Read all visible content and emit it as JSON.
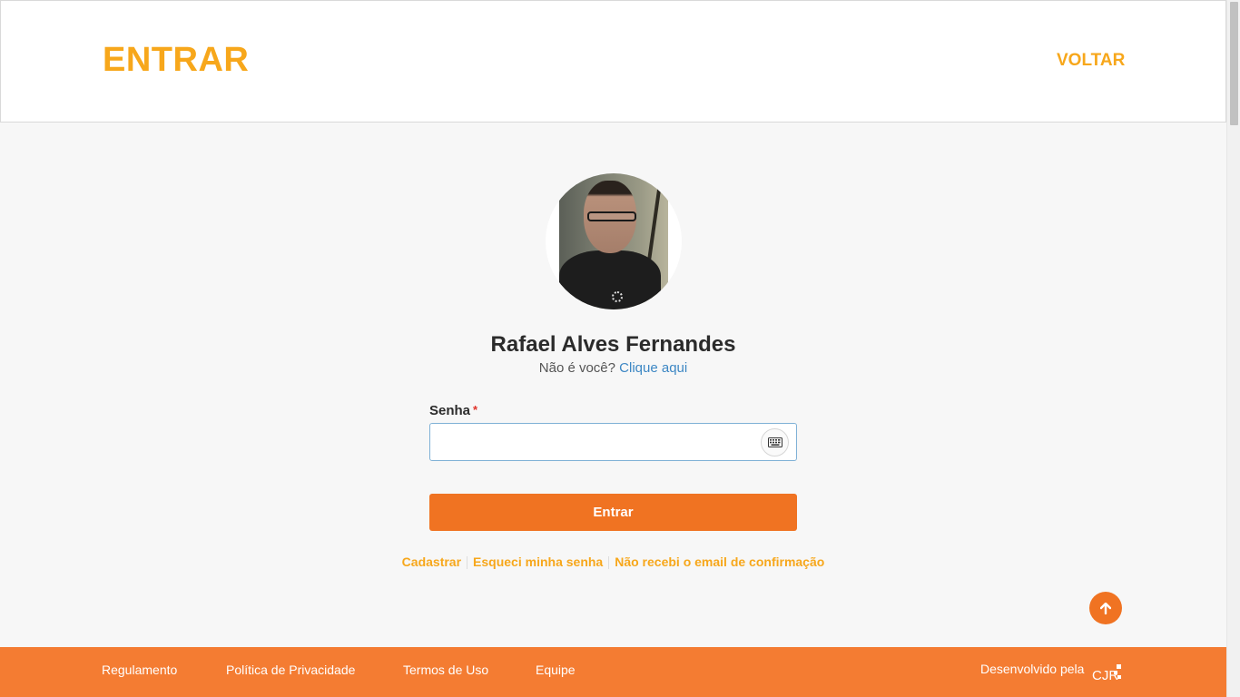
{
  "header": {
    "title": "ENTRAR",
    "back_label": "VOLTAR"
  },
  "user": {
    "name": "Rafael Alves Fernandes",
    "not_you_text": "Não é você?",
    "not_you_link": "Clique aqui"
  },
  "form": {
    "password_label": "Senha",
    "required_mark": "*",
    "password_value": "",
    "submit_label": "Entrar"
  },
  "links": {
    "register": "Cadastrar",
    "forgot_password": "Esqueci minha senha",
    "no_confirmation_email": "Não recebi o email de confirmação"
  },
  "footer": {
    "items": [
      "Regulamento",
      "Política de Privacidade",
      "Termos de Uso",
      "Equipe"
    ],
    "developed_by": "Desenvolvido pela",
    "logo_text": "CJR"
  },
  "icons": {
    "keyboard": "keyboard-icon",
    "back_to_top": "arrow-up-icon"
  },
  "colors": {
    "accent_yellow": "#f7a71b",
    "accent_orange": "#f07322",
    "footer_orange": "#f47c32",
    "link_blue": "#3d87c4"
  }
}
